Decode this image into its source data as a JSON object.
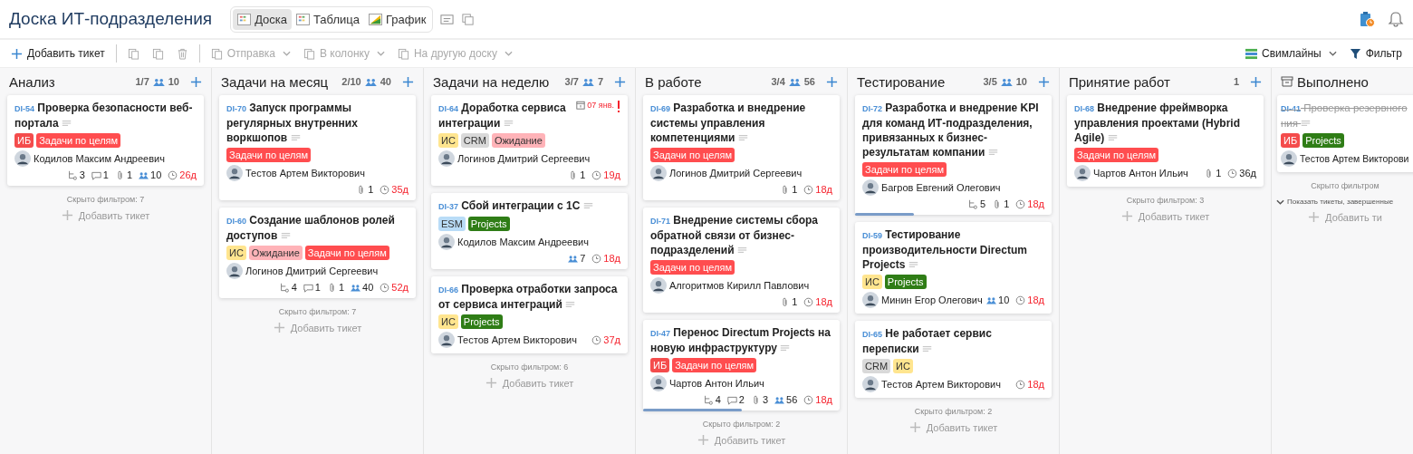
{
  "header": {
    "title": "Доска ИТ-подразделения",
    "views": [
      {
        "label": "Доска",
        "selected": true
      },
      {
        "label": "Таблица",
        "selected": false
      },
      {
        "label": "График",
        "selected": false
      }
    ]
  },
  "toolbar": {
    "left": [
      {
        "kind": "add",
        "label": "Добавить тикет",
        "disabled": false
      },
      {
        "kind": "paste",
        "disabled": true
      },
      {
        "kind": "copy",
        "disabled": true
      },
      {
        "kind": "delete",
        "disabled": true
      },
      {
        "kind": "send",
        "label": "Отправка",
        "disabled": true
      },
      {
        "kind": "column",
        "label": "В колонку",
        "disabled": true
      },
      {
        "kind": "board",
        "label": "На другую доску",
        "disabled": true
      }
    ],
    "right": [
      {
        "kind": "swimlanes",
        "label": "Свимлайны"
      },
      {
        "kind": "filter",
        "label": "Фильтр"
      }
    ]
  },
  "columns": [
    {
      "name": "Анализ",
      "count": "1/7",
      "points": "10",
      "archived": false,
      "cards": [
        {
          "id": "DI-54",
          "title": "Проверка безопасности веб-портала",
          "done": false,
          "tags": [
            {
              "label": "ИБ",
              "color": "#f44c4c"
            },
            {
              "label": "Задачи по целям",
              "color": "#ff4d4f"
            }
          ],
          "assignee": "Кодилов Максим Андреевич",
          "stats": {
            "subtasks": "3",
            "comments": "1",
            "attachments": "1",
            "points": "10",
            "days": "26д"
          },
          "overdue": true
        }
      ],
      "hidden": "Скрыто фильтром: 7",
      "add": "Добавить тикет"
    },
    {
      "name": "Задачи на месяц",
      "count": "2/10",
      "points": "40",
      "archived": false,
      "cards": [
        {
          "id": "DI-70",
          "title": "Запуск программы регулярных внутренних воркшопов",
          "done": false,
          "tags": [
            {
              "label": "Задачи по целям",
              "color": "#ff4d4f"
            }
          ],
          "assignee": "Тестов Артем Викторович",
          "stats": {
            "attachments": "1",
            "days": "35д"
          },
          "overdue": true
        },
        {
          "id": "DI-60",
          "title": "Создание шаблонов ролей доступов",
          "done": false,
          "tags": [
            {
              "label": "ИС",
              "color": "#ffe58f"
            },
            {
              "label": "Ожидание",
              "color": "#ffb3b8"
            },
            {
              "label": "Задачи по целям",
              "color": "#ff4d4f"
            }
          ],
          "assignee": "Логинов Дмитрий Сергеевич",
          "stats": {
            "subtasks": "4",
            "comments": "1",
            "attachments": "1",
            "points": "40",
            "days": "52д"
          },
          "overdue": true
        }
      ],
      "hidden": "Скрыто фильтром: 7",
      "add": "Добавить тикет"
    },
    {
      "name": "Задачи на неделю",
      "count": "3/7",
      "points": "7",
      "archived": false,
      "cards": [
        {
          "id": "DI-64",
          "title": "Доработка сервиса интеграции",
          "done": false,
          "due": "07 янв.",
          "urgent": true,
          "tags": [
            {
              "label": "ИС",
              "color": "#ffe58f"
            },
            {
              "label": "CRM",
              "color": "#d9d9d9"
            },
            {
              "label": "Ожидание",
              "color": "#ffb3b8"
            }
          ],
          "assignee": "Логинов Дмитрий Сергеевич",
          "stats": {
            "attachments": "1",
            "days": "19д"
          },
          "overdue": true
        },
        {
          "id": "DI-37",
          "title": "Сбой интеграции с 1С",
          "done": false,
          "tags": [
            {
              "label": "ESM",
              "color": "#b9dcf7"
            },
            {
              "label": "Projects",
              "color": "#2f7d16"
            }
          ],
          "assignee": "Кодилов Максим Андреевич",
          "stats": {
            "points": "7",
            "days": "18д"
          },
          "overdue": true
        },
        {
          "id": "DI-66",
          "title": "Проверка отработки запроса от сервиса интеграций",
          "done": false,
          "tags": [
            {
              "label": "ИС",
              "color": "#ffe58f"
            },
            {
              "label": "Projects",
              "color": "#2f7d16"
            }
          ],
          "assignee": "Тестов Артем Викторович",
          "stats": {
            "days": "37д"
          },
          "overdue": true
        }
      ],
      "hidden": "Скрыто фильтром: 6",
      "add": "Добавить тикет"
    },
    {
      "name": "В работе",
      "count": "3/4",
      "points": "56",
      "archived": false,
      "cards": [
        {
          "id": "DI-69",
          "title": "Разработка и внедрение системы управления компетенциями",
          "done": false,
          "tags": [
            {
              "label": "Задачи по целям",
              "color": "#ff4d4f"
            }
          ],
          "assignee": "Логинов Дмитрий Сергеевич",
          "stats": {
            "attachments": "1",
            "days": "18д"
          },
          "overdue": true
        },
        {
          "id": "DI-71",
          "title": "Внедрение системы сбора обратной связи от бизнес-подразделений",
          "done": false,
          "tags": [
            {
              "label": "Задачи по целям",
              "color": "#ff4d4f"
            }
          ],
          "assignee": "Алгоритмов Кирилл Павлович",
          "stats": {
            "attachments": "1",
            "days": "18д"
          },
          "overdue": true
        },
        {
          "id": "DI-47",
          "title": "Перенос Directum Projects на новую инфраструктуру",
          "done": false,
          "tags": [
            {
              "label": "ИБ",
              "color": "#f44c4c"
            },
            {
              "label": "Задачи по целям",
              "color": "#ff4d4f"
            }
          ],
          "assignee": "Чартов Антон Ильич",
          "stats": {
            "subtasks": "4",
            "comments": "2",
            "attachments": "3",
            "points": "56",
            "days": "18д"
          },
          "overdue": true,
          "level": 0.5
        }
      ],
      "hidden": "Скрыто фильтром: 2",
      "add": "Добавить тикет"
    },
    {
      "name": "Тестирование",
      "count": "3/5",
      "points": "10",
      "archived": false,
      "cards": [
        {
          "id": "DI-72",
          "title": "Разработка и внедрение KPI для команд ИТ-подразделения, привязанных к бизнес-результатам компании",
          "done": false,
          "tags": [
            {
              "label": "Задачи по целям",
              "color": "#ff4d4f"
            }
          ],
          "assignee": "Багров Евгений Олегович",
          "stats": {
            "subtasks": "5",
            "attachments": "1",
            "days": "18д"
          },
          "overdue": true,
          "level": 0.3
        },
        {
          "id": "DI-59",
          "title": "Тестирование производительности Directum Projects",
          "done": false,
          "tags": [
            {
              "label": "ИС",
              "color": "#ffe58f"
            },
            {
              "label": "Projects",
              "color": "#2f7d16"
            }
          ],
          "assignee": "Минин Егор Олегович",
          "stats": {
            "points": "10",
            "days": "18д"
          },
          "overdue": true
        },
        {
          "id": "DI-65",
          "title": "Не работает сервис переписки",
          "done": false,
          "tags": [
            {
              "label": "CRM",
              "color": "#d9d9d9"
            },
            {
              "label": "ИС",
              "color": "#ffe58f"
            }
          ],
          "assignee": "Тестов Артем Викторович",
          "stats": {
            "days": "18д"
          },
          "overdue": true
        }
      ],
      "hidden": "Скрыто фильтром: 2",
      "add": "Добавить тикет"
    },
    {
      "name": "Принятие работ",
      "count": "1",
      "archived": false,
      "cards": [
        {
          "id": "DI-68",
          "title": "Внедрение фреймворка управления проектами (Hybrid Agile)",
          "done": false,
          "tags": [
            {
              "label": "Задачи по целям",
              "color": "#ff4d4f"
            }
          ],
          "assignee": "Чартов Антон Ильич",
          "stats": {
            "attachments": "1",
            "days": "36д"
          },
          "overdue": false
        }
      ],
      "hidden": "Скрыто фильтром: 3",
      "add": "Добавить тикет"
    },
    {
      "name": "Выполнено",
      "archived": true,
      "cards": [
        {
          "id": "DI-41",
          "title": "Проверка резервного\nния",
          "done": true,
          "tags": [
            {
              "label": "ИБ",
              "color": "#f44c4c"
            },
            {
              "label": "Projects",
              "color": "#2f7d16"
            }
          ],
          "assignee": "Тестов Артем Викторови"
        }
      ],
      "hidden": "Скрыто фильтром",
      "show_completed": "Показать тикеты, завершенные",
      "add": "Добавить ти"
    }
  ]
}
